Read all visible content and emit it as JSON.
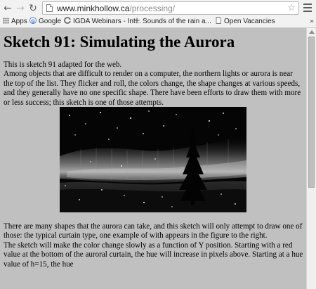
{
  "browser": {
    "url_domain": "www.minkhollow.ca",
    "url_path": "/processing/",
    "back_icon": "←",
    "forward_icon": "→",
    "reload_icon": "↻",
    "star_icon": "☆",
    "bookmarks": [
      {
        "label": "Apps",
        "icon": "apps-grid-icon"
      },
      {
        "label": "Google",
        "icon": "google-favicon"
      },
      {
        "label": "IGDA Webinars - Int...",
        "icon": "igda-favicon"
      },
      {
        "label": "Sounds of the rain a...",
        "icon": "sparkle-favicon"
      },
      {
        "label": "Open Vacancies",
        "icon": "page-favicon"
      }
    ],
    "more_bookmarks": "»"
  },
  "page": {
    "title": "Sketch 91: Simulating the Aurora",
    "intro": "This is sketch 91 adapted for the web.",
    "paragraph1": "Among objects that are difficult to render on a computer, the northern lights or aurora is near the top of the list. They flicker and roll, the colors change, the shape changes at various speeds, and they generally have no one specific shape. There have been efforts to draw them with more or less success; this sketch is one of those attempts.",
    "paragraph2": "There are many shapes that the aurora can take, and this sketch will only attempt to draw one of those: the typical curtain type, one example of with appears in the figure to the right.",
    "paragraph3": "The sketch will make the color change slowly as a function of Y position. Starting with a red value at the bottom of the auroral curtain, the hue will increase in pixels above. Starting at a hue value of h=15, the hue"
  },
  "colors": {
    "page_background": "#c0c0c0",
    "canvas_background": "#060606"
  }
}
